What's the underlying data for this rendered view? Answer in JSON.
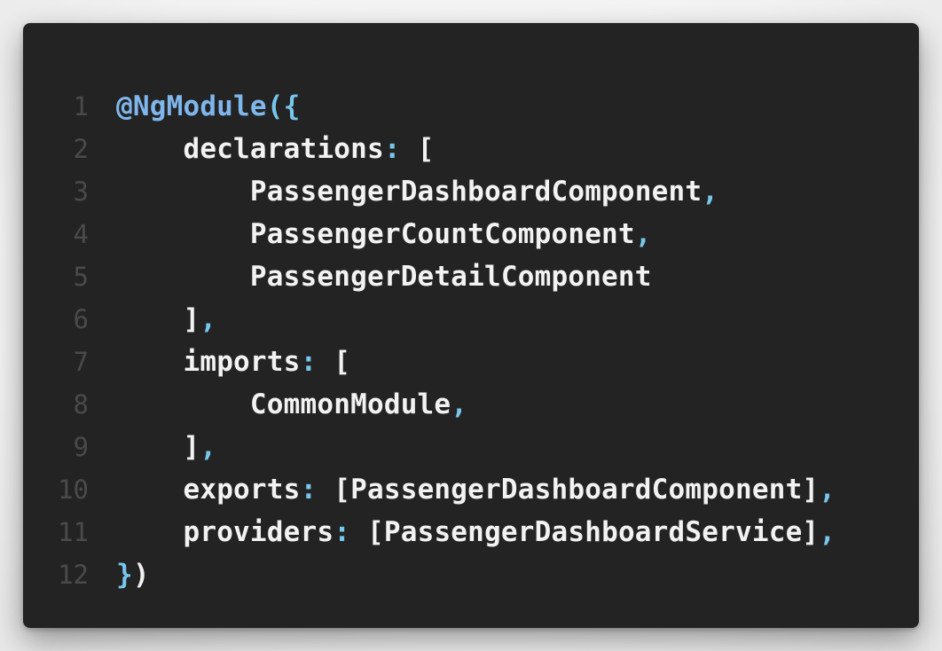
{
  "editor": {
    "colors": {
      "background": "#232323",
      "line_number": "#4a4a4a",
      "identifier": "#f2f2f2",
      "punctuation": "#77c6ec",
      "decorator": "#7fb6ec"
    },
    "lines": [
      {
        "number": "1",
        "indent": "",
        "parts": [
          {
            "text": "@NgModule",
            "kind": "deco"
          },
          {
            "text": "({",
            "kind": "punct"
          }
        ]
      },
      {
        "number": "2",
        "indent": "    ",
        "parts": [
          {
            "text": "declarations",
            "kind": "ident"
          },
          {
            "text": ": ",
            "kind": "punct"
          },
          {
            "text": "[",
            "kind": "bracket"
          }
        ]
      },
      {
        "number": "3",
        "indent": "        ",
        "parts": [
          {
            "text": "PassengerDashboardComponent",
            "kind": "ident"
          },
          {
            "text": ",",
            "kind": "punct"
          }
        ]
      },
      {
        "number": "4",
        "indent": "        ",
        "parts": [
          {
            "text": "PassengerCountComponent",
            "kind": "ident"
          },
          {
            "text": ",",
            "kind": "punct"
          }
        ]
      },
      {
        "number": "5",
        "indent": "        ",
        "parts": [
          {
            "text": "PassengerDetailComponent",
            "kind": "ident"
          }
        ]
      },
      {
        "number": "6",
        "indent": "    ",
        "parts": [
          {
            "text": "]",
            "kind": "bracket"
          },
          {
            "text": ",",
            "kind": "punct"
          }
        ]
      },
      {
        "number": "7",
        "indent": "    ",
        "parts": [
          {
            "text": "imports",
            "kind": "ident"
          },
          {
            "text": ": ",
            "kind": "punct"
          },
          {
            "text": "[",
            "kind": "bracket"
          }
        ]
      },
      {
        "number": "8",
        "indent": "        ",
        "parts": [
          {
            "text": "CommonModule",
            "kind": "ident"
          },
          {
            "text": ",",
            "kind": "punct"
          }
        ]
      },
      {
        "number": "9",
        "indent": "    ",
        "parts": [
          {
            "text": "]",
            "kind": "bracket"
          },
          {
            "text": ",",
            "kind": "punct"
          }
        ]
      },
      {
        "number": "10",
        "indent": "    ",
        "parts": [
          {
            "text": "exports",
            "kind": "ident"
          },
          {
            "text": ": ",
            "kind": "punct"
          },
          {
            "text": "[PassengerDashboardComponent]",
            "kind": "bracket"
          },
          {
            "text": ",",
            "kind": "punct"
          }
        ]
      },
      {
        "number": "11",
        "indent": "    ",
        "parts": [
          {
            "text": "providers",
            "kind": "ident"
          },
          {
            "text": ": ",
            "kind": "punct"
          },
          {
            "text": "[PassengerDashboardService]",
            "kind": "bracket"
          },
          {
            "text": ",",
            "kind": "punct"
          }
        ]
      },
      {
        "number": "12",
        "indent": "",
        "parts": [
          {
            "text": "}",
            "kind": "punct"
          },
          {
            "text": ")",
            "kind": "bracket"
          }
        ]
      }
    ]
  }
}
